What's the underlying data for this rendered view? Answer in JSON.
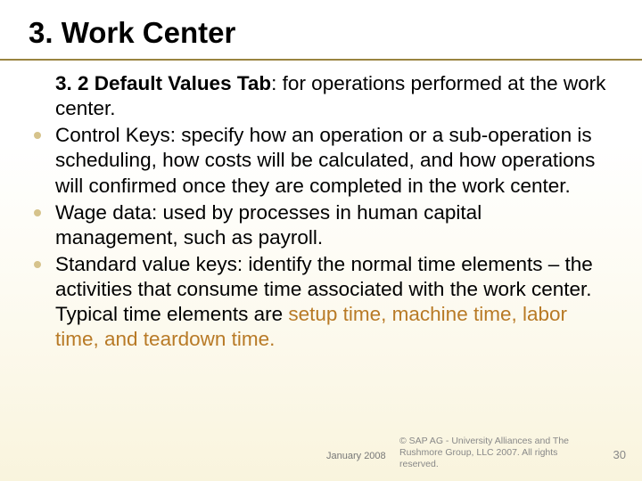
{
  "title": "3. Work Center",
  "lead": {
    "bold": "3. 2 Default Values Tab",
    "rest": ": for operations performed at the work center."
  },
  "bullets": [
    "Control Keys: specify how an operation or a sub-operation is scheduling, how costs will be calculated, and how operations will confirmed once they are completed in the work center.",
    "Wage data: used by processes in human capital management, such as payroll."
  ],
  "bullet_sv": {
    "pre": "Standard value keys: identify the normal time elements – the activities that consume time associated with the work center. Typical time elements are ",
    "accent": "setup time, machine time, labor time, and teardown time."
  },
  "footer": {
    "date": "January 2008",
    "copy": "© SAP AG - University Alliances and The Rushmore Group, LLC 2007. All rights reserved.",
    "page": "30"
  }
}
